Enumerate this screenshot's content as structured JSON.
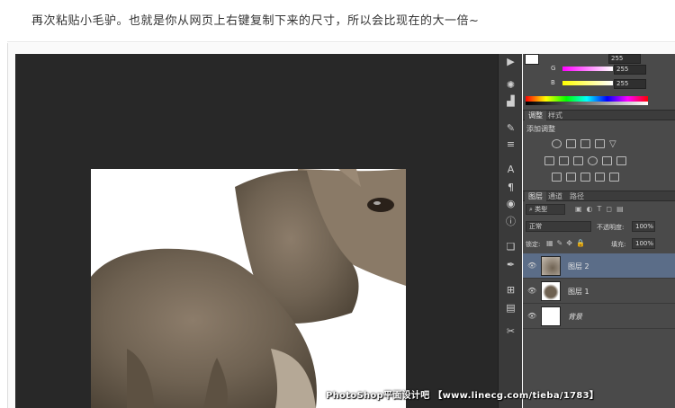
{
  "caption": "再次粘贴小毛驴。也就是你从网页上右键复制下来的尺寸，所以会比现在的大一倍~",
  "color_panel": {
    "g_label": "G",
    "g_value": "255",
    "b_label": "B",
    "b_value": "255",
    "top_value": "255"
  },
  "adjust_tabs": [
    "调整",
    "样式"
  ],
  "adjust_title": "添加调整",
  "layer_tabs": [
    "图层",
    "通道",
    "路径"
  ],
  "kind_filter": "类型",
  "blend_mode": "正常",
  "opacity_label": "不透明度:",
  "opacity_value": "100%",
  "lock_label": "锁定:",
  "fill_label": "填充:",
  "fill_value": "100%",
  "layers": [
    {
      "name": "图层 2",
      "selected": true
    },
    {
      "name": "图层 1",
      "selected": false
    },
    {
      "name": "背景",
      "selected": false
    }
  ],
  "watermark": "PhotoShop平面设计吧  【www.linecg.com/tieba/1783】",
  "colors": {
    "canvas": "#282828",
    "panel": "#4a4a4a",
    "selected_layer": "#5b6d88"
  },
  "icons": [
    "play-icon",
    "color-picker-icon",
    "histogram-icon",
    "brush-icon",
    "sliders-icon",
    "character-icon",
    "paragraph-icon",
    "adjustments-icon",
    "info-icon",
    "clone-icon",
    "path-icon",
    "transform-icon",
    "notes-icon",
    "tools-icon",
    "eye-icon"
  ]
}
